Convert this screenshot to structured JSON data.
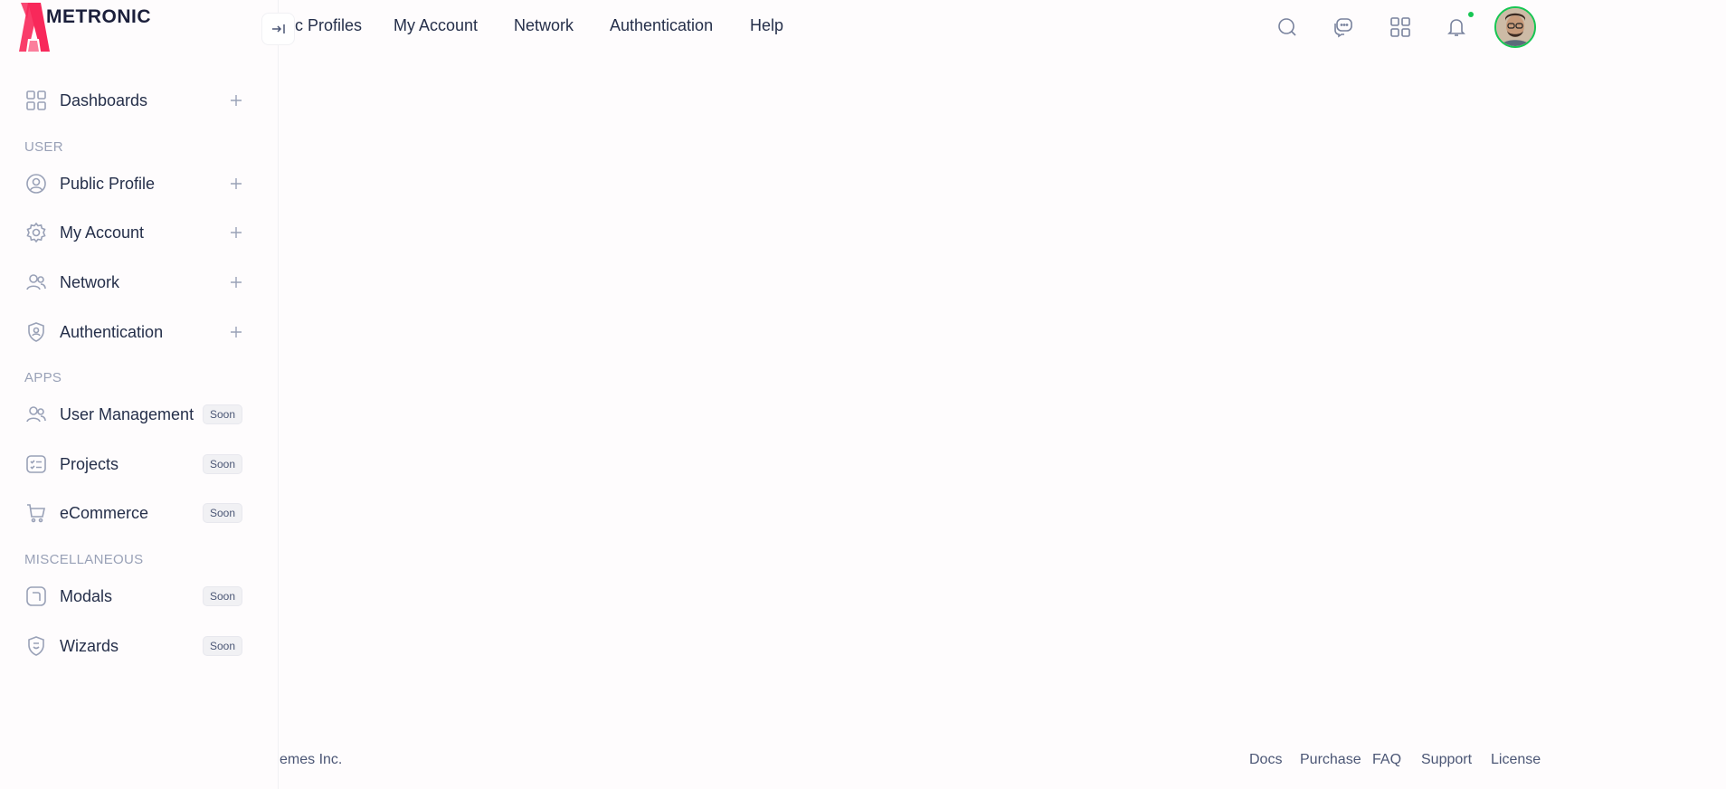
{
  "brand": {
    "name": "METRONIC"
  },
  "sidebar": {
    "items": [
      {
        "label": "Dashboards",
        "icon": "dashboard-grid-icon"
      },
      {
        "label": "Public Profile",
        "icon": "profile-circle-icon"
      },
      {
        "label": "My Account",
        "icon": "gear-icon"
      },
      {
        "label": "Network",
        "icon": "users-icon"
      },
      {
        "label": "Authentication",
        "icon": "shield-user-icon"
      },
      {
        "label": "User Management",
        "icon": "users-icon",
        "badge": "Soon"
      },
      {
        "label": "Projects",
        "icon": "checklist-icon",
        "badge": "Soon"
      },
      {
        "label": "eCommerce",
        "icon": "cart-icon",
        "badge": "Soon"
      },
      {
        "label": "Modals",
        "icon": "modal-icon",
        "badge": "Soon"
      },
      {
        "label": "Wizards",
        "icon": "wizard-icon",
        "badge": "Soon"
      }
    ],
    "sections": {
      "user": "USER",
      "apps": "APPS",
      "misc": "MISCELLANEOUS"
    }
  },
  "header": {
    "nav": [
      "c Profiles",
      "My Account",
      "Network",
      "Authentication",
      "Help"
    ],
    "icons": [
      "search-icon",
      "chat-icon",
      "apps-grid-icon",
      "notification-bell-icon"
    ],
    "status_color": "#17c653"
  },
  "footer": {
    "copyright": "emes Inc.",
    "links": [
      "Docs",
      "Purchase",
      "FAQ",
      "Support",
      "License"
    ]
  }
}
